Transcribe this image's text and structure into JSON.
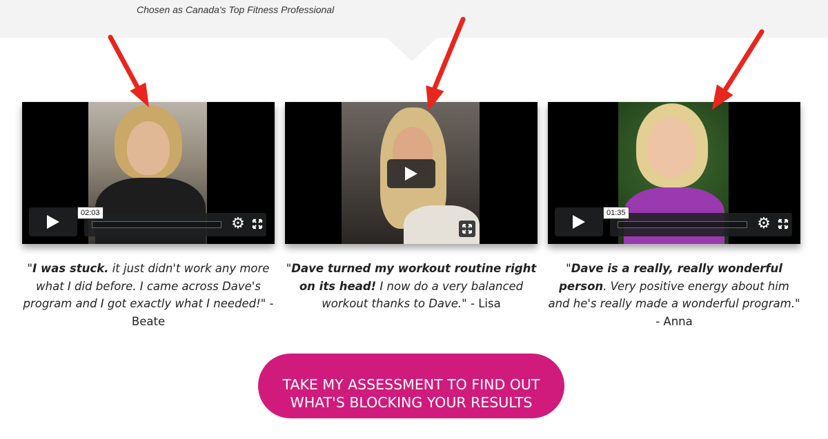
{
  "header": {
    "caption": "Chosen as Canada's Top Fitness Professional"
  },
  "videos": [
    {
      "time_tooltip": "02:03",
      "controls": "bar"
    },
    {
      "time_tooltip": "",
      "controls": "centered-play"
    },
    {
      "time_tooltip": "01:35",
      "controls": "bar"
    }
  ],
  "testimonials": [
    {
      "open_quote": "\"",
      "bold": "I was stuck.",
      "italic": " it just didn't work any more what I did before. I came across Dave's program and I got exactly what I needed!\"",
      "author": " - Beate"
    },
    {
      "open_quote": "\"",
      "bold": "Dave turned my workout routine right on its head!",
      "italic": " I now do a very balanced workout thanks to Dave.\"",
      "author": " - Lisa"
    },
    {
      "open_quote": "\"",
      "bold": "Dave is a really, really wonderful person",
      "italic": ". Very positive energy about him and he's really made a wonderful program.\"",
      "author": " - Anna"
    }
  ],
  "cta": {
    "line1": "TAKE MY ASSESSMENT TO FIND OUT",
    "line2": "WHAT'S BLOCKING YOUR RESULTS"
  },
  "colors": {
    "cta": "#d11b7c",
    "arrow": "#e8261e",
    "band": "#f3f3f3"
  },
  "icons": [
    "play-icon",
    "gear-icon",
    "fullscreen-icon",
    "arrow-pointer"
  ]
}
